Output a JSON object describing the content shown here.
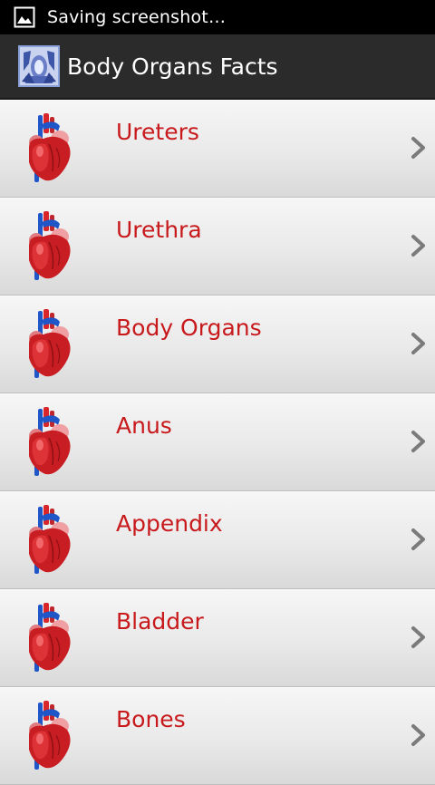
{
  "status_bar": {
    "icon": "image-icon",
    "text": "Saving screenshot…"
  },
  "action_bar": {
    "icon": "app-logo-icon",
    "title": "Body Organs Facts"
  },
  "list": {
    "row_icon": "heart-icon",
    "row_chevron": "chevron-right-icon",
    "items": [
      {
        "label": "Ureters"
      },
      {
        "label": "Urethra"
      },
      {
        "label": "Body Organs"
      },
      {
        "label": "Anus"
      },
      {
        "label": "Appendix"
      },
      {
        "label": "Bladder"
      },
      {
        "label": "Bones"
      }
    ]
  },
  "colors": {
    "label": "#c8191c",
    "action_bar": "#2b2b2b",
    "status_bar": "#000000"
  }
}
